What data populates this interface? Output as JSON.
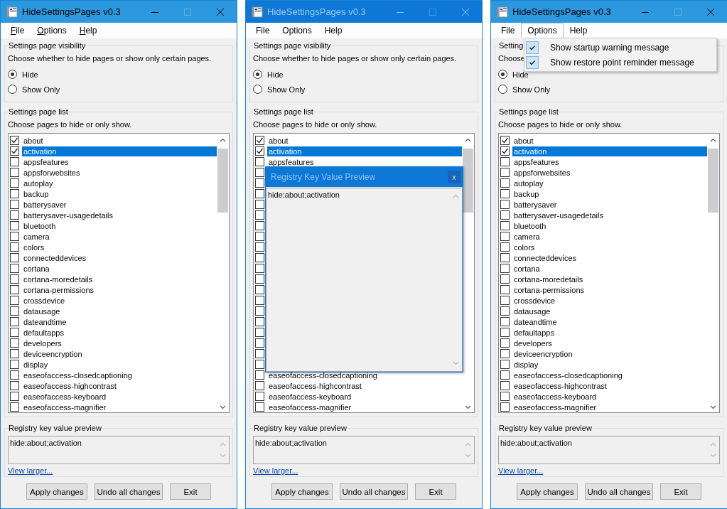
{
  "windows": [
    {
      "title": "HideSettingsPages v0.3",
      "active": true,
      "maximize_disabled": true,
      "menu": {
        "access_keys": true,
        "items": [
          {
            "label": "File",
            "open": false
          },
          {
            "label": "Options",
            "open": false
          },
          {
            "label": "Help",
            "open": false
          }
        ]
      },
      "visibility_group": {
        "title": "Settings page visibility",
        "description": "Choose whether to hide pages or show only certain pages.",
        "options": [
          {
            "label": "Hide",
            "selected": true
          },
          {
            "label": "Show Only",
            "selected": false
          }
        ]
      },
      "list_group": {
        "title": "Settings page list",
        "description": "Choose pages to hide or only show.",
        "items": [
          {
            "label": "about",
            "checked": true,
            "selected": false
          },
          {
            "label": "activation",
            "checked": true,
            "selected": true
          },
          {
            "label": "appsfeatures",
            "checked": false,
            "selected": false
          },
          {
            "label": "appsforwebsites",
            "checked": false,
            "selected": false
          },
          {
            "label": "autoplay",
            "checked": false,
            "selected": false
          },
          {
            "label": "backup",
            "checked": false,
            "selected": false
          },
          {
            "label": "batterysaver",
            "checked": false,
            "selected": false
          },
          {
            "label": "batterysaver-usagedetails",
            "checked": false,
            "selected": false
          },
          {
            "label": "bluetooth",
            "checked": false,
            "selected": false
          },
          {
            "label": "camera",
            "checked": false,
            "selected": false
          },
          {
            "label": "colors",
            "checked": false,
            "selected": false
          },
          {
            "label": "connecteddevices",
            "checked": false,
            "selected": false
          },
          {
            "label": "cortana",
            "checked": false,
            "selected": false
          },
          {
            "label": "cortana-moredetails",
            "checked": false,
            "selected": false
          },
          {
            "label": "cortana-permissions",
            "checked": false,
            "selected": false
          },
          {
            "label": "crossdevice",
            "checked": false,
            "selected": false
          },
          {
            "label": "datausage",
            "checked": false,
            "selected": false
          },
          {
            "label": "dateandtime",
            "checked": false,
            "selected": false
          },
          {
            "label": "defaultapps",
            "checked": false,
            "selected": false
          },
          {
            "label": "developers",
            "checked": false,
            "selected": false
          },
          {
            "label": "deviceencryption",
            "checked": false,
            "selected": false
          },
          {
            "label": "display",
            "checked": false,
            "selected": false
          },
          {
            "label": "easeofaccess-closedcaptioning",
            "checked": false,
            "selected": false
          },
          {
            "label": "easeofaccess-highcontrast",
            "checked": false,
            "selected": false
          },
          {
            "label": "easeofaccess-keyboard",
            "checked": false,
            "selected": false
          },
          {
            "label": "easeofaccess-magnifier",
            "checked": false,
            "selected": false
          }
        ]
      },
      "preview_group": {
        "title": "Registry key value preview",
        "value": "hide:about;activation"
      },
      "link": "View larger...",
      "buttons": [
        "Apply changes",
        "Undo all changes",
        "Exit"
      ]
    },
    {
      "title": "HideSettingsPages v0.3",
      "active": false,
      "maximize_disabled": true,
      "menu": {
        "access_keys": false,
        "items": [
          {
            "label": "File",
            "open": false
          },
          {
            "label": "Options",
            "open": false
          },
          {
            "label": "Help",
            "open": false
          }
        ]
      },
      "visibility_group": {
        "title": "Settings page visibility",
        "description": "Choose whether to hide pages or show only certain pages.",
        "options": [
          {
            "label": "Hide",
            "selected": true
          },
          {
            "label": "Show Only",
            "selected": false
          }
        ]
      },
      "list_group": {
        "title": "Settings page list",
        "description": "Choose pages to hide or only show.",
        "items": [
          {
            "label": "about",
            "checked": true,
            "selected": false
          },
          {
            "label": "activation",
            "checked": true,
            "selected": true
          },
          {
            "label": "appsfeatures",
            "checked": false,
            "selected": false
          },
          {
            "checked": false
          },
          {
            "checked": false
          },
          {
            "checked": false
          },
          {
            "checked": false
          },
          {
            "checked": false
          },
          {
            "checked": false
          },
          {
            "checked": false
          },
          {
            "checked": false
          },
          {
            "checked": false
          },
          {
            "checked": false
          },
          {
            "checked": false
          },
          {
            "checked": false
          },
          {
            "checked": false
          },
          {
            "checked": false
          },
          {
            "checked": false
          },
          {
            "checked": false
          },
          {
            "checked": false
          },
          {
            "checked": false
          },
          {
            "checked": false
          },
          {
            "label": "easeofaccess-closedcaptioning",
            "checked": false,
            "selected": false
          },
          {
            "label": "easeofaccess-highcontrast",
            "checked": false,
            "selected": false
          },
          {
            "label": "easeofaccess-keyboard",
            "checked": false,
            "selected": false
          },
          {
            "label": "easeofaccess-magnifier",
            "checked": false,
            "selected": false
          }
        ]
      },
      "preview_group": {
        "title": "Registry key value preview",
        "value": "hide:about;activation"
      },
      "link": "View larger...",
      "buttons": [
        "Apply changes",
        "Undo all changes",
        "Exit"
      ],
      "popup": {
        "title": "Registry Key Value Preview",
        "close_label": "x",
        "value": "hide:about;activation"
      }
    },
    {
      "title": "HideSettingsPages v0.3",
      "active": true,
      "maximize_disabled": true,
      "menu": {
        "access_keys": false,
        "items": [
          {
            "label": "File",
            "open": false
          },
          {
            "label": "Options",
            "open": true
          },
          {
            "label": "Help",
            "open": false
          }
        ]
      },
      "options_menu": {
        "items": [
          {
            "label": "Show startup warning message",
            "checked": true
          },
          {
            "label": "Show restore point reminder message",
            "checked": true
          }
        ]
      },
      "visibility_group": {
        "title": "Setting",
        "description": "Choose",
        "options": [
          {
            "label": "Hide",
            "selected": true
          },
          {
            "label": "Show Only",
            "selected": false
          }
        ]
      },
      "list_group": {
        "title": "Settings page list",
        "description": "Choose pages to hide or only show.",
        "items": [
          {
            "label": "about",
            "checked": true,
            "selected": false
          },
          {
            "label": "activation",
            "checked": true,
            "selected": true
          },
          {
            "label": "appsfeatures",
            "checked": false,
            "selected": false
          },
          {
            "label": "appsforwebsites",
            "checked": false,
            "selected": false
          },
          {
            "label": "autoplay",
            "checked": false,
            "selected": false
          },
          {
            "label": "backup",
            "checked": false,
            "selected": false
          },
          {
            "label": "batterysaver",
            "checked": false,
            "selected": false
          },
          {
            "label": "batterysaver-usagedetails",
            "checked": false,
            "selected": false
          },
          {
            "label": "bluetooth",
            "checked": false,
            "selected": false
          },
          {
            "label": "camera",
            "checked": false,
            "selected": false
          },
          {
            "label": "colors",
            "checked": false,
            "selected": false
          },
          {
            "label": "connecteddevices",
            "checked": false,
            "selected": false
          },
          {
            "label": "cortana",
            "checked": false,
            "selected": false
          },
          {
            "label": "cortana-moredetails",
            "checked": false,
            "selected": false
          },
          {
            "label": "cortana-permissions",
            "checked": false,
            "selected": false
          },
          {
            "label": "crossdevice",
            "checked": false,
            "selected": false
          },
          {
            "label": "datausage",
            "checked": false,
            "selected": false
          },
          {
            "label": "dateandtime",
            "checked": false,
            "selected": false
          },
          {
            "label": "defaultapps",
            "checked": false,
            "selected": false
          },
          {
            "label": "developers",
            "checked": false,
            "selected": false
          },
          {
            "label": "deviceencryption",
            "checked": false,
            "selected": false
          },
          {
            "label": "display",
            "checked": false,
            "selected": false
          },
          {
            "label": "easeofaccess-closedcaptioning",
            "checked": false,
            "selected": false
          },
          {
            "label": "easeofaccess-highcontrast",
            "checked": false,
            "selected": false
          },
          {
            "label": "easeofaccess-keyboard",
            "checked": false,
            "selected": false
          },
          {
            "label": "easeofaccess-magnifier",
            "checked": false,
            "selected": false
          }
        ]
      },
      "preview_group": {
        "title": "Registry key value preview",
        "value": "hide:about;activation"
      },
      "link": "View larger...",
      "buttons": [
        "Apply changes",
        "Undo all changes",
        "Exit"
      ]
    }
  ]
}
